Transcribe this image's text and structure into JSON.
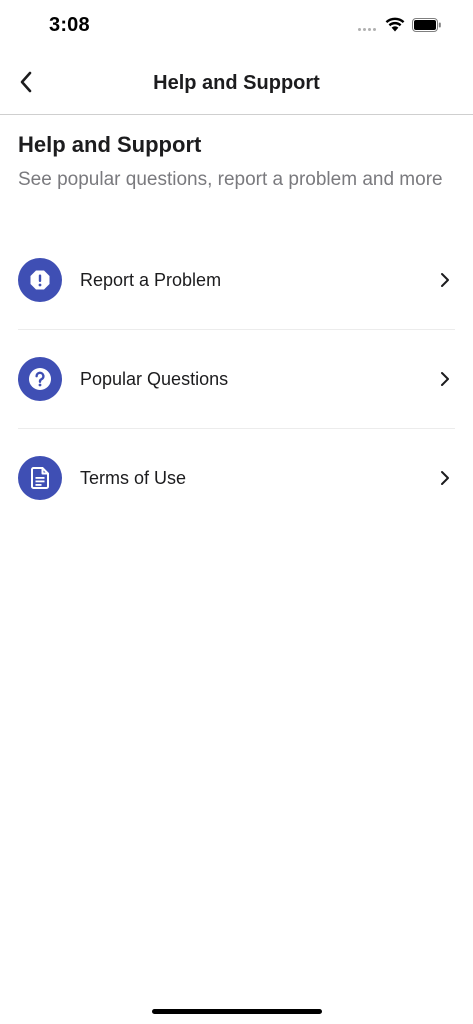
{
  "status_bar": {
    "time": "3:08"
  },
  "nav": {
    "title": "Help and Support",
    "back_icon": "chevron-left-icon"
  },
  "header": {
    "heading": "Help and Support",
    "subtitle": "See popular questions, report a problem and more"
  },
  "menu": {
    "items": [
      {
        "label": "Report a Problem",
        "icon": "exclamation-octagon-icon"
      },
      {
        "label": "Popular Questions",
        "icon": "question-circle-icon"
      },
      {
        "label": "Terms of Use",
        "icon": "document-icon"
      }
    ]
  },
  "colors": {
    "accent": "#3f4fb4",
    "text": "#1c1c1e",
    "subtitle": "#7a7a7e",
    "divider": "#ececec"
  }
}
